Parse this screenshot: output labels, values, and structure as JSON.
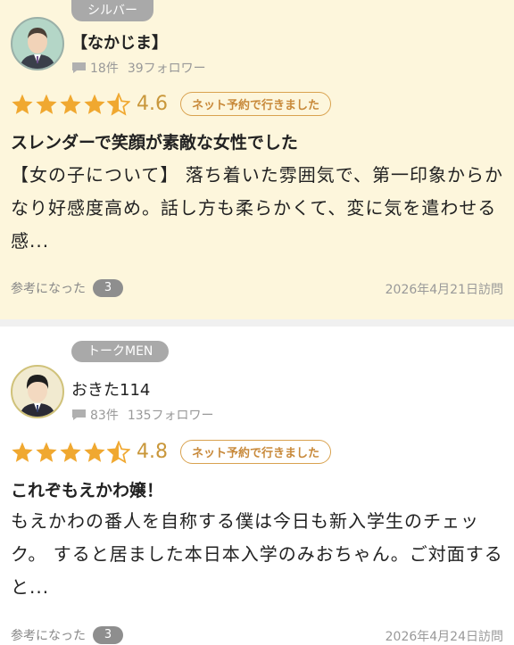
{
  "reviews": [
    {
      "rank": "シルバー",
      "username": "【なかじま】",
      "review_count": "18件",
      "followers": "39フォロワー",
      "rating": "4.6",
      "badge": "ネット予約で行きました",
      "title": "スレンダーで笑顔が素敵な女性でした",
      "body": "【女の子について】 落ち着いた雰囲気で、第一印象からかなり好感度高め。話し方も柔らかくて、変に気を遣わせる感...",
      "helpful_label": "参考になった",
      "helpful_count": "3",
      "visit_date": "2026年4月21日訪問"
    },
    {
      "rank": "トークMEN",
      "username": "おきた114",
      "review_count": "83件",
      "followers": "135フォロワー",
      "rating": "4.8",
      "badge": "ネット予約で行きました",
      "title": "これぞもえかわ嬢！",
      "body": "もえかわの番人を自称する僕は今日も新入学生のチェック。 すると居ました本日本入学のみおちゃん。ご対面すると...",
      "helpful_label": "参考になった",
      "helpful_count": "3",
      "visit_date": "2026年4月24日訪問"
    }
  ],
  "colors": {
    "star": "#f0a830",
    "score": "#c9973a",
    "badge_border": "#d9a24f",
    "card1_bg": "#fdf6dc",
    "rank_bg": "#a9a9a9"
  },
  "icons": {
    "comment": "comment-icon",
    "star": "star-icon",
    "half_star": "half-star-icon"
  }
}
